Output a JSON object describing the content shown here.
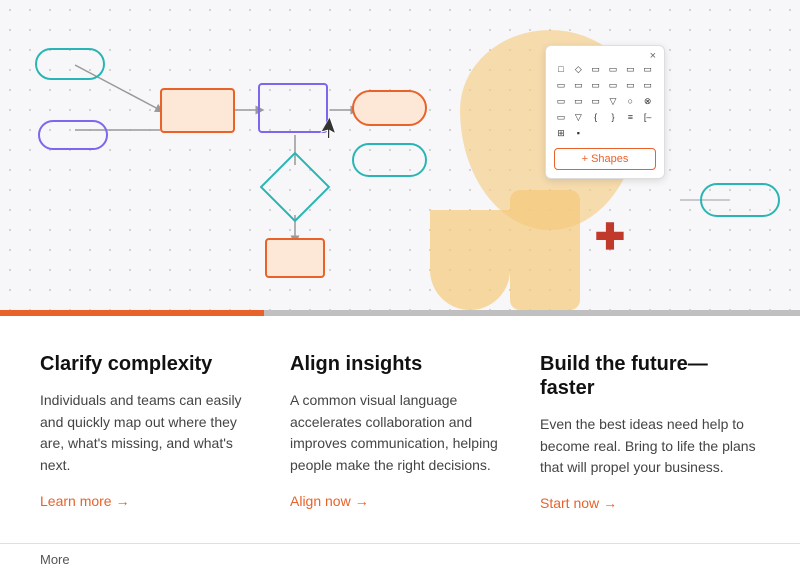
{
  "hero": {
    "shapes_panel": {
      "close_label": "×",
      "button_label": "+ Shapes",
      "icon_rows": [
        [
          "□",
          "◇",
          "⬜",
          "⬜",
          "▭",
          "▭"
        ],
        [
          "▭",
          "▭",
          "▭",
          "▭",
          "▭",
          "▭"
        ],
        [
          "▭",
          "▭",
          "▭",
          "▽",
          "○",
          "⊗"
        ],
        [
          "▭",
          "▽",
          "⟨",
          "⟩",
          "≡",
          "[–"
        ],
        [
          "⊞",
          "▪",
          "",
          "",
          "",
          ""
        ]
      ]
    }
  },
  "divider": {
    "orange_pct": 33,
    "gray_pct": 67
  },
  "columns": [
    {
      "heading": "Clarify complexity",
      "body": "Individuals and teams can easily and quickly map out where they are, what's missing, and what's next.",
      "link_text": "Learn more",
      "link_arrow": "→"
    },
    {
      "heading": "Align insights",
      "body": "A common visual language accelerates collaboration and improves communication, helping people make the right decisions.",
      "link_text": "Align now",
      "link_arrow": "→"
    },
    {
      "heading": "Build the future—faster",
      "body": "Even the best ideas need help to become real. Bring to life the plans that will propel your business.",
      "link_text": "Start now",
      "link_arrow": "→"
    }
  ],
  "bottom_bar": {
    "more_label": "More"
  }
}
